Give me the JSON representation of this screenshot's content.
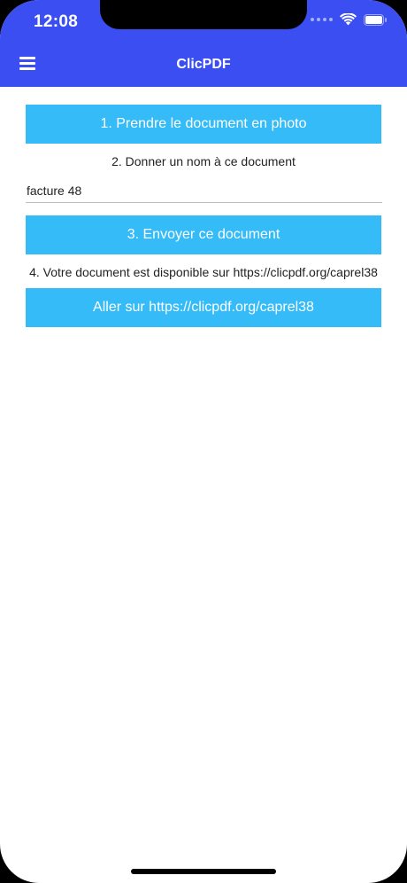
{
  "status_bar": {
    "time": "12:08",
    "wifi_icon": "wifi-icon",
    "battery_icon": "battery-icon"
  },
  "header": {
    "title": "ClicPDF",
    "menu_icon": "hamburger-menu-icon",
    "background_color": "#3a4ef2"
  },
  "steps": {
    "take_photo_label": "1. Prendre le document en photo",
    "name_instruction": "2. Donner un nom à ce document",
    "document_name_value": "facture 48",
    "send_label": "3. Envoyer ce document",
    "availability_text": "4. Votre document est disponible sur https://clicpdf.org/caprel38",
    "go_to_site_label": "Aller sur https://clicpdf.org/caprel38"
  },
  "colors": {
    "button": "#34bbf8",
    "header": "#3a4ef2"
  }
}
